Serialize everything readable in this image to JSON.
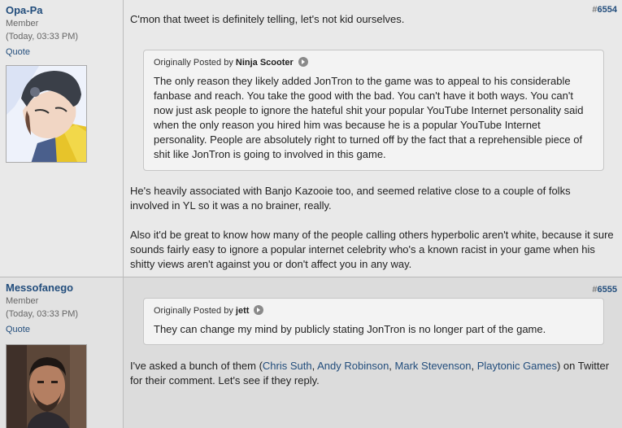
{
  "posts": [
    {
      "username": "Opa-Pa",
      "usertitle": "Member",
      "posttime": "(Today, 03:33 PM)",
      "quote_label": "Quote",
      "post_number_hash": "#",
      "post_number": "6554",
      "paragraph1": "C'mon that tweet is definitely telling, let's not kid ourselves.",
      "quote": {
        "prefix": "Originally Posted by",
        "author": "Ninja Scooter",
        "text": "The only reason they likely added JonTron to the game was to appeal to his considerable fanbase and reach. You take the good with the bad. You can't have it both ways. You can't now just ask people to ignore the hateful shit your popular YouTube Internet personality said when the only reason you hired him was because he is a popular YouTube Internet personality. People are absolutely right to turned off by the fact that a reprehensible piece of shit like JonTron is going to involved in this game."
      },
      "paragraph2": "He's heavily associated with Banjo Kazooie too, and seemed relative close to a couple of folks involved in YL so it was a no brainer, really.",
      "paragraph3": "Also it'd be great to know how many of the people calling others hyperbolic aren't white, because it sure sounds fairly easy to ignore a popular internet celebrity who's a known racist in your game when his shitty views aren't against you or don't affect you in any way."
    },
    {
      "username": "Messofanego",
      "usertitle": "Member",
      "posttime": "(Today, 03:33 PM)",
      "quote_label": "Quote",
      "post_number_hash": "#",
      "post_number": "6555",
      "quote": {
        "prefix": "Originally Posted by",
        "author": "jett",
        "text": "They can change my mind by publicly stating JonTron is no longer part of the game."
      },
      "body_before": "I've asked a bunch of them (",
      "links": [
        "Chris Suth",
        "Andy Robinson",
        "Mark Stevenson",
        "Playtonic Games"
      ],
      "sep": ", ",
      "body_after": ") on Twitter for their comment. Let's see if they reply."
    }
  ]
}
